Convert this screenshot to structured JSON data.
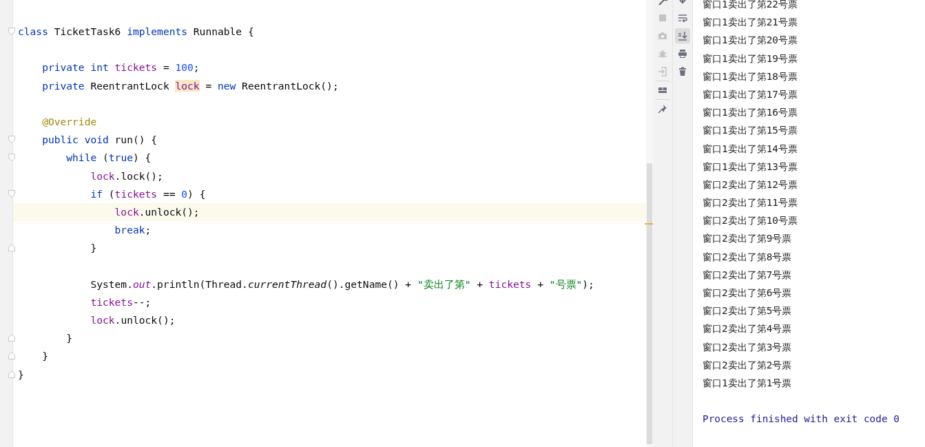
{
  "editor": {
    "lines": [
      {
        "kind": "block-start",
        "current": false,
        "tokens": [
          {
            "kind": "keyword",
            "text": "class"
          },
          {
            "kind": "plain",
            "text": " TicketTask6 "
          },
          {
            "kind": "keyword",
            "text": "implements"
          },
          {
            "kind": "plain",
            "text": " Runnable {"
          }
        ]
      },
      {
        "kind": "blank",
        "current": false
      },
      {
        "kind": "statement",
        "current": false,
        "tokens": [
          {
            "kind": "keyword",
            "text": "    private int"
          },
          {
            "kind": "field",
            "text": " tickets"
          },
          {
            "kind": "plain",
            "text": " = "
          },
          {
            "kind": "number",
            "text": "100"
          },
          {
            "kind": "plain",
            "text": ";"
          }
        ]
      },
      {
        "kind": "statement",
        "current": false,
        "tokens": [
          {
            "kind": "keyword",
            "text": "    private"
          },
          {
            "kind": "plain",
            "text": " ReentrantLock "
          },
          {
            "kind": "usage",
            "text": "lock"
          },
          {
            "kind": "plain",
            "text": " = "
          },
          {
            "kind": "keyword",
            "text": "new"
          },
          {
            "kind": "plain",
            "text": " ReentrantLock();"
          }
        ]
      },
      {
        "kind": "blank",
        "current": false
      },
      {
        "kind": "statement",
        "current": false,
        "tokens": [
          {
            "kind": "annotation",
            "text": "    @Override"
          }
        ]
      },
      {
        "kind": "block-start",
        "current": false,
        "tokens": [
          {
            "kind": "keyword",
            "text": "    public void"
          },
          {
            "kind": "plain",
            "text": " run() {"
          }
        ]
      },
      {
        "kind": "block-start",
        "current": false,
        "tokens": [
          {
            "kind": "keyword",
            "text": "        while"
          },
          {
            "kind": "plain",
            "text": " ("
          },
          {
            "kind": "keyword",
            "text": "true"
          },
          {
            "kind": "plain",
            "text": ") {"
          }
        ]
      },
      {
        "kind": "statement",
        "current": false,
        "tokens": [
          {
            "kind": "field",
            "text": "            lock"
          },
          {
            "kind": "plain",
            "text": ".lock();"
          }
        ]
      },
      {
        "kind": "block-start",
        "current": false,
        "tokens": [
          {
            "kind": "keyword",
            "text": "            if"
          },
          {
            "kind": "plain",
            "text": " ("
          },
          {
            "kind": "field",
            "text": "tickets"
          },
          {
            "kind": "plain",
            "text": " == "
          },
          {
            "kind": "number",
            "text": "0"
          },
          {
            "kind": "plain",
            "text": ") {"
          }
        ]
      },
      {
        "kind": "statement",
        "current": true,
        "tokens": [
          {
            "kind": "field",
            "text": "                lock"
          },
          {
            "kind": "plain",
            "text": ".unlock();"
          }
        ]
      },
      {
        "kind": "statement",
        "current": false,
        "tokens": [
          {
            "kind": "keyword",
            "text": "                break"
          },
          {
            "kind": "plain",
            "text": ";"
          }
        ]
      },
      {
        "kind": "block-end",
        "current": false,
        "tokens": [
          {
            "kind": "plain",
            "text": "            }"
          }
        ]
      },
      {
        "kind": "blank",
        "current": false
      },
      {
        "kind": "statement",
        "current": false,
        "tokens": [
          {
            "kind": "plain",
            "text": "            System."
          },
          {
            "kind": "static",
            "text": "out"
          },
          {
            "kind": "plain",
            "text": ".println(Thread."
          },
          {
            "kind": "italic",
            "text": "currentThread"
          },
          {
            "kind": "plain",
            "text": "().getName() + "
          },
          {
            "kind": "string",
            "text": "\"卖出了第\""
          },
          {
            "kind": "plain",
            "text": " + "
          },
          {
            "kind": "field",
            "text": "tickets"
          },
          {
            "kind": "plain",
            "text": " + "
          },
          {
            "kind": "string",
            "text": "\"号票\""
          },
          {
            "kind": "plain",
            "text": ");"
          }
        ]
      },
      {
        "kind": "statement",
        "current": false,
        "tokens": [
          {
            "kind": "field",
            "text": "            tickets"
          },
          {
            "kind": "plain",
            "text": "--;"
          }
        ]
      },
      {
        "kind": "statement",
        "current": false,
        "tokens": [
          {
            "kind": "field",
            "text": "            lock"
          },
          {
            "kind": "plain",
            "text": ".unlock();"
          }
        ]
      },
      {
        "kind": "block-end",
        "current": false,
        "tokens": [
          {
            "kind": "plain",
            "text": "        }"
          }
        ]
      },
      {
        "kind": "block-end",
        "current": false,
        "tokens": [
          {
            "kind": "plain",
            "text": "    }"
          }
        ]
      },
      {
        "kind": "block-end",
        "current": false,
        "tokens": [
          {
            "kind": "plain",
            "text": "}"
          }
        ]
      }
    ]
  },
  "run_tools": [
    {
      "kind": "wrench",
      "disabled": false
    },
    {
      "kind": "stop",
      "disabled": true
    },
    {
      "kind": "camera",
      "disabled": true
    },
    {
      "kind": "bug",
      "disabled": true
    },
    {
      "kind": "exit",
      "disabled": true
    },
    {
      "kind": "separator"
    },
    {
      "kind": "layout",
      "disabled": false
    },
    {
      "kind": "separator"
    },
    {
      "kind": "pin",
      "disabled": false
    }
  ],
  "console_tools": [
    {
      "kind": "down",
      "selected": false
    },
    {
      "kind": "wrap",
      "selected": false
    },
    {
      "kind": "scroll-end",
      "selected": true
    },
    {
      "kind": "print",
      "selected": false
    },
    {
      "kind": "trash",
      "selected": false
    }
  ],
  "console": {
    "lines": [
      "窗口1卖出了第22号票",
      "窗口1卖出了第21号票",
      "窗口1卖出了第20号票",
      "窗口1卖出了第19号票",
      "窗口1卖出了第18号票",
      "窗口1卖出了第17号票",
      "窗口1卖出了第16号票",
      "窗口1卖出了第15号票",
      "窗口1卖出了第14号票",
      "窗口1卖出了第13号票",
      "窗口2卖出了第12号票",
      "窗口2卖出了第11号票",
      "窗口2卖出了第10号票",
      "窗口2卖出了第9号票",
      "窗口2卖出了第8号票",
      "窗口2卖出了第7号票",
      "窗口2卖出了第6号票",
      "窗口2卖出了第5号票",
      "窗口2卖出了第4号票",
      "窗口2卖出了第3号票",
      "窗口2卖出了第2号票",
      "窗口1卖出了第1号票"
    ],
    "exit_message": "Process finished with exit code 0"
  }
}
